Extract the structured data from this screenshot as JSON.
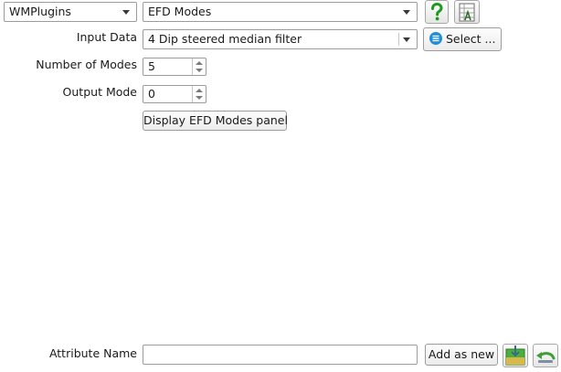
{
  "toolbar": {
    "plugin_selector": "WMPlugins",
    "attribute_selector": "EFD Modes",
    "help_icon": "question-mark-icon",
    "display_icon": "attribute-display-icon"
  },
  "form": {
    "input_data_label": "Input Data",
    "input_data_value": "4 Dip steered median filter",
    "select_button": "Select ...",
    "select_icon": "list-icon",
    "num_modes_label": "Number of Modes",
    "num_modes_value": "5",
    "output_mode_label": "Output Mode",
    "output_mode_value": "0",
    "display_panel_button": "Display EFD Modes panel"
  },
  "footer": {
    "attr_name_label": "Attribute Name",
    "attr_name_value": "",
    "add_as_new_button": "Add as new",
    "save_icon": "save-attribute-icon",
    "undo_icon": "revert-icon"
  },
  "colors": {
    "help_green": "#1c9a1c",
    "select_blue": "#1e8fd6"
  }
}
